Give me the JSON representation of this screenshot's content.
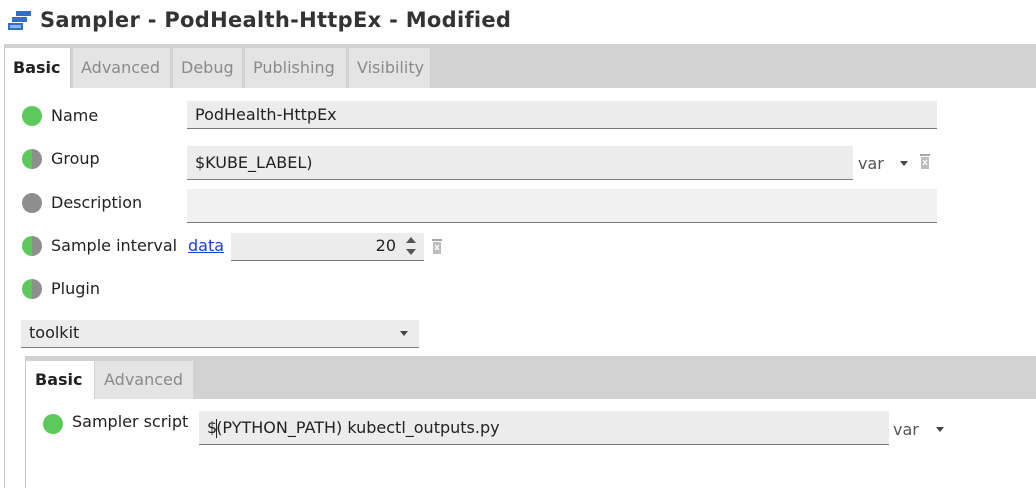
{
  "window": {
    "title": "Sampler - PodHealth-HttpEx - Modified",
    "icon": "sampler-stack-icon",
    "accent_color": "#2f6fc7"
  },
  "tabs": [
    {
      "label": "Basic",
      "active": true
    },
    {
      "label": "Advanced",
      "active": false
    },
    {
      "label": "Debug",
      "active": false
    },
    {
      "label": "Publishing",
      "active": false
    },
    {
      "label": "Visibility",
      "active": false
    }
  ],
  "form": {
    "name": {
      "label": "Name",
      "value": "PodHealth-HttpEx",
      "status": "green"
    },
    "group": {
      "label": "Group",
      "value": "$KUBE_LABEL)",
      "status": "mixed",
      "var_label": "var"
    },
    "description": {
      "label": "Description",
      "value": "",
      "status": "gray"
    },
    "sample_interval": {
      "label": "Sample interval",
      "link": "data",
      "value": "20",
      "status": "mixed"
    },
    "plugin": {
      "label": "Plugin",
      "status": "mixed",
      "selected": "toolkit"
    }
  },
  "subtabs": [
    {
      "label": "Basic",
      "active": true
    },
    {
      "label": "Advanced",
      "active": false
    }
  ],
  "toolkit": {
    "sampler_script": {
      "label": "Sampler script",
      "value_before_cursor": "$",
      "value_after_cursor": "(PYTHON_PATH) kubectl_outputs.py",
      "status": "green",
      "var_label": "var"
    }
  },
  "colors": {
    "status_green": "#5cc95c",
    "status_gray": "#8e8e8e",
    "link": "#1a3fcf"
  }
}
